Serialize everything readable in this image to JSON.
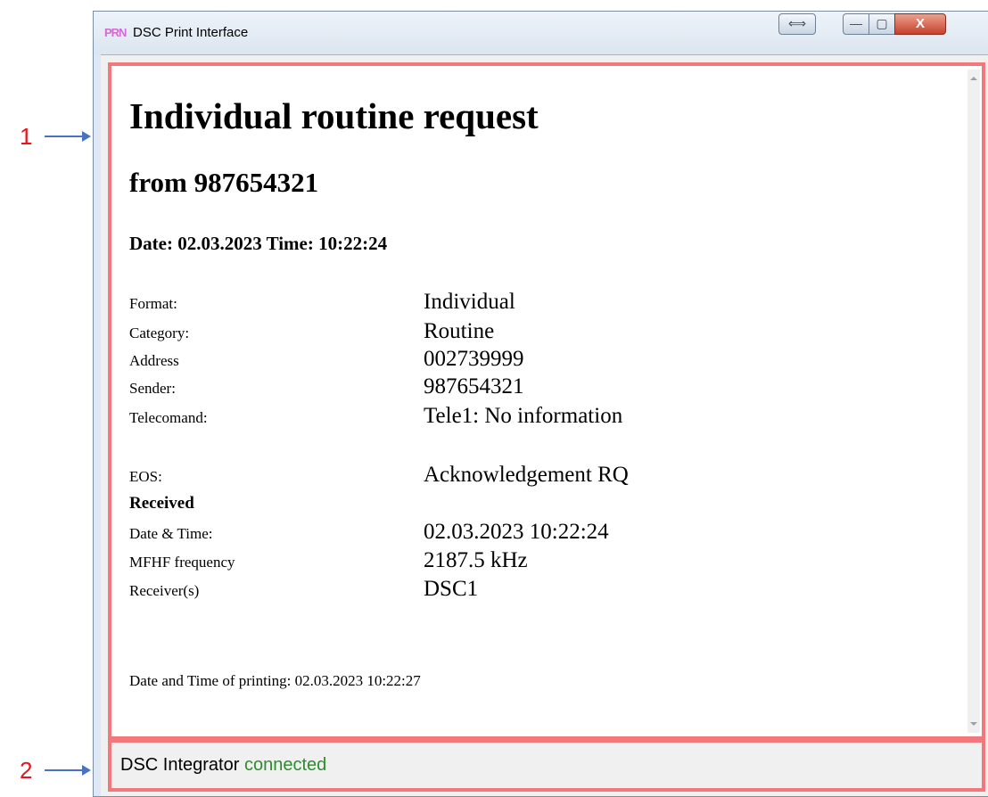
{
  "callouts": [
    "1",
    "2"
  ],
  "window": {
    "title": "DSC Print Interface",
    "icon_name": "app-icon",
    "icon_text": "PRN",
    "buttons": {
      "resize": "⟺",
      "minimize": "—",
      "maximize": "▢",
      "close": "X"
    }
  },
  "document": {
    "heading": "Individual routine request",
    "from": "from 987654321",
    "datetime": "Date: 02.03.2023 Time: 10:22:24",
    "fields": [
      {
        "label": "Format:",
        "value": "Individual"
      },
      {
        "label": "Category:",
        "value": "Routine"
      },
      {
        "label": "Address",
        "value": "002739999"
      },
      {
        "label": "Sender:",
        "value": "987654321"
      },
      {
        "label": "Telecomand:",
        "value": "Tele1: No information"
      }
    ],
    "eos": {
      "label": "EOS:",
      "value": "Acknowledgement RQ"
    },
    "received_heading": "Received",
    "received_fields": [
      {
        "label": "Date & Time:",
        "value": "02.03.2023 10:22:24"
      },
      {
        "label": "MFHF frequency",
        "value": "2187.5 kHz"
      },
      {
        "label": "Receiver(s)",
        "value": "DSC1"
      }
    ],
    "footer": "Date and Time of printing: 02.03.2023 10:22:27"
  },
  "status": {
    "label": "DSC Integrator",
    "value": "connected",
    "value_color": "#2e8b2e"
  },
  "colors": {
    "highlight_border": "#f2787c",
    "callout_text": "#e8141b",
    "arrow": "#4a72c4"
  }
}
